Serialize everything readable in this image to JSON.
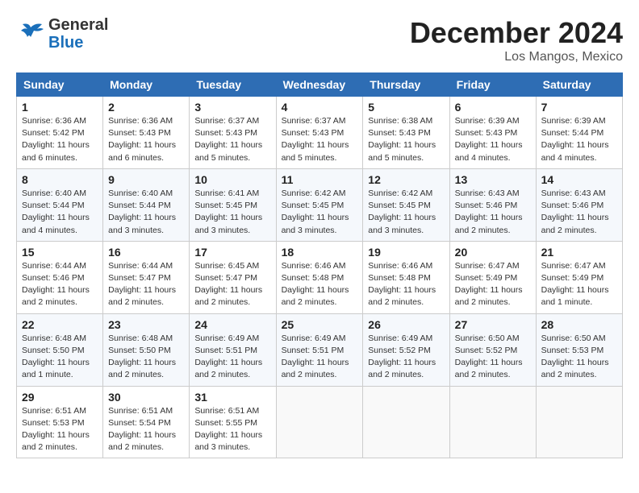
{
  "header": {
    "logo": {
      "general": "General",
      "blue": "Blue"
    },
    "title": "December 2024",
    "location": "Los Mangos, Mexico"
  },
  "weekdays": [
    "Sunday",
    "Monday",
    "Tuesday",
    "Wednesday",
    "Thursday",
    "Friday",
    "Saturday"
  ],
  "weeks": [
    [
      {
        "day": 1,
        "info": "Sunrise: 6:36 AM\nSunset: 5:42 PM\nDaylight: 11 hours\nand 6 minutes."
      },
      {
        "day": 2,
        "info": "Sunrise: 6:36 AM\nSunset: 5:43 PM\nDaylight: 11 hours\nand 6 minutes."
      },
      {
        "day": 3,
        "info": "Sunrise: 6:37 AM\nSunset: 5:43 PM\nDaylight: 11 hours\nand 5 minutes."
      },
      {
        "day": 4,
        "info": "Sunrise: 6:37 AM\nSunset: 5:43 PM\nDaylight: 11 hours\nand 5 minutes."
      },
      {
        "day": 5,
        "info": "Sunrise: 6:38 AM\nSunset: 5:43 PM\nDaylight: 11 hours\nand 5 minutes."
      },
      {
        "day": 6,
        "info": "Sunrise: 6:39 AM\nSunset: 5:43 PM\nDaylight: 11 hours\nand 4 minutes."
      },
      {
        "day": 7,
        "info": "Sunrise: 6:39 AM\nSunset: 5:44 PM\nDaylight: 11 hours\nand 4 minutes."
      }
    ],
    [
      {
        "day": 8,
        "info": "Sunrise: 6:40 AM\nSunset: 5:44 PM\nDaylight: 11 hours\nand 4 minutes."
      },
      {
        "day": 9,
        "info": "Sunrise: 6:40 AM\nSunset: 5:44 PM\nDaylight: 11 hours\nand 3 minutes."
      },
      {
        "day": 10,
        "info": "Sunrise: 6:41 AM\nSunset: 5:45 PM\nDaylight: 11 hours\nand 3 minutes."
      },
      {
        "day": 11,
        "info": "Sunrise: 6:42 AM\nSunset: 5:45 PM\nDaylight: 11 hours\nand 3 minutes."
      },
      {
        "day": 12,
        "info": "Sunrise: 6:42 AM\nSunset: 5:45 PM\nDaylight: 11 hours\nand 3 minutes."
      },
      {
        "day": 13,
        "info": "Sunrise: 6:43 AM\nSunset: 5:46 PM\nDaylight: 11 hours\nand 2 minutes."
      },
      {
        "day": 14,
        "info": "Sunrise: 6:43 AM\nSunset: 5:46 PM\nDaylight: 11 hours\nand 2 minutes."
      }
    ],
    [
      {
        "day": 15,
        "info": "Sunrise: 6:44 AM\nSunset: 5:46 PM\nDaylight: 11 hours\nand 2 minutes."
      },
      {
        "day": 16,
        "info": "Sunrise: 6:44 AM\nSunset: 5:47 PM\nDaylight: 11 hours\nand 2 minutes."
      },
      {
        "day": 17,
        "info": "Sunrise: 6:45 AM\nSunset: 5:47 PM\nDaylight: 11 hours\nand 2 minutes."
      },
      {
        "day": 18,
        "info": "Sunrise: 6:46 AM\nSunset: 5:48 PM\nDaylight: 11 hours\nand 2 minutes."
      },
      {
        "day": 19,
        "info": "Sunrise: 6:46 AM\nSunset: 5:48 PM\nDaylight: 11 hours\nand 2 minutes."
      },
      {
        "day": 20,
        "info": "Sunrise: 6:47 AM\nSunset: 5:49 PM\nDaylight: 11 hours\nand 2 minutes."
      },
      {
        "day": 21,
        "info": "Sunrise: 6:47 AM\nSunset: 5:49 PM\nDaylight: 11 hours\nand 1 minute."
      }
    ],
    [
      {
        "day": 22,
        "info": "Sunrise: 6:48 AM\nSunset: 5:50 PM\nDaylight: 11 hours\nand 1 minute."
      },
      {
        "day": 23,
        "info": "Sunrise: 6:48 AM\nSunset: 5:50 PM\nDaylight: 11 hours\nand 2 minutes."
      },
      {
        "day": 24,
        "info": "Sunrise: 6:49 AM\nSunset: 5:51 PM\nDaylight: 11 hours\nand 2 minutes."
      },
      {
        "day": 25,
        "info": "Sunrise: 6:49 AM\nSunset: 5:51 PM\nDaylight: 11 hours\nand 2 minutes."
      },
      {
        "day": 26,
        "info": "Sunrise: 6:49 AM\nSunset: 5:52 PM\nDaylight: 11 hours\nand 2 minutes."
      },
      {
        "day": 27,
        "info": "Sunrise: 6:50 AM\nSunset: 5:52 PM\nDaylight: 11 hours\nand 2 minutes."
      },
      {
        "day": 28,
        "info": "Sunrise: 6:50 AM\nSunset: 5:53 PM\nDaylight: 11 hours\nand 2 minutes."
      }
    ],
    [
      {
        "day": 29,
        "info": "Sunrise: 6:51 AM\nSunset: 5:53 PM\nDaylight: 11 hours\nand 2 minutes."
      },
      {
        "day": 30,
        "info": "Sunrise: 6:51 AM\nSunset: 5:54 PM\nDaylight: 11 hours\nand 2 minutes."
      },
      {
        "day": 31,
        "info": "Sunrise: 6:51 AM\nSunset: 5:55 PM\nDaylight: 11 hours\nand 3 minutes."
      },
      {
        "day": null,
        "info": ""
      },
      {
        "day": null,
        "info": ""
      },
      {
        "day": null,
        "info": ""
      },
      {
        "day": null,
        "info": ""
      }
    ]
  ]
}
